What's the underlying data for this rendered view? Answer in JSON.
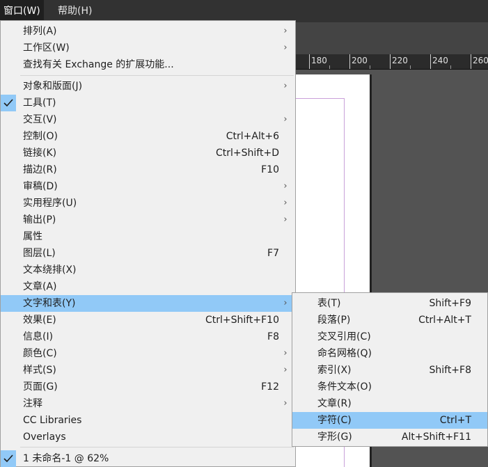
{
  "menubar": {
    "window_label": "窗口(W)",
    "help_label": "帮助(H)"
  },
  "ruler": {
    "labels": [
      "180",
      "200",
      "220",
      "240",
      "260"
    ]
  },
  "window_menu": {
    "items": [
      {
        "label": "排列(A)",
        "submenu": true
      },
      {
        "label": "工作区(W)",
        "submenu": true
      },
      {
        "label": "查找有关 Exchange 的扩展功能..."
      },
      {
        "label": "对象和版面(J)",
        "submenu": true
      },
      {
        "label": "工具(T)",
        "checked": true
      },
      {
        "label": "交互(V)",
        "submenu": true
      },
      {
        "label": "控制(O)",
        "shortcut": "Ctrl+Alt+6"
      },
      {
        "label": "链接(K)",
        "shortcut": "Ctrl+Shift+D"
      },
      {
        "label": "描边(R)",
        "shortcut": "F10"
      },
      {
        "label": "审稿(D)",
        "submenu": true
      },
      {
        "label": "实用程序(U)",
        "submenu": true
      },
      {
        "label": "输出(P)",
        "submenu": true
      },
      {
        "label": "属性"
      },
      {
        "label": "图层(L)",
        "shortcut": "F7"
      },
      {
        "label": "文本绕排(X)"
      },
      {
        "label": "文章(A)"
      },
      {
        "label": "文字和表(Y)",
        "submenu": true,
        "highlighted": true
      },
      {
        "label": "效果(E)",
        "shortcut": "Ctrl+Shift+F10"
      },
      {
        "label": "信息(I)",
        "shortcut": "F8"
      },
      {
        "label": "颜色(C)",
        "submenu": true
      },
      {
        "label": "样式(S)",
        "submenu": true
      },
      {
        "label": "页面(G)",
        "shortcut": "F12"
      },
      {
        "label": "注释",
        "submenu": true
      },
      {
        "label": "CC Libraries"
      },
      {
        "label": "Overlays"
      },
      {
        "label": "1 未命名-1 @ 62%",
        "checked": true
      }
    ]
  },
  "type_tables_submenu": {
    "items": [
      {
        "label": "表(T)",
        "shortcut": "Shift+F9"
      },
      {
        "label": "段落(P)",
        "shortcut": "Ctrl+Alt+T"
      },
      {
        "label": "交叉引用(C)"
      },
      {
        "label": "命名网格(Q)"
      },
      {
        "label": "索引(X)",
        "shortcut": "Shift+F8"
      },
      {
        "label": "条件文本(O)"
      },
      {
        "label": "文章(R)"
      },
      {
        "label": "字符(C)",
        "shortcut": "Ctrl+T",
        "highlighted": true
      },
      {
        "label": "字形(G)",
        "shortcut": "Alt+Shift+F11"
      }
    ]
  },
  "colors": {
    "highlight": "#91c9f7",
    "menu_bg": "#f0f0f0",
    "menubar_bg": "#323232"
  }
}
